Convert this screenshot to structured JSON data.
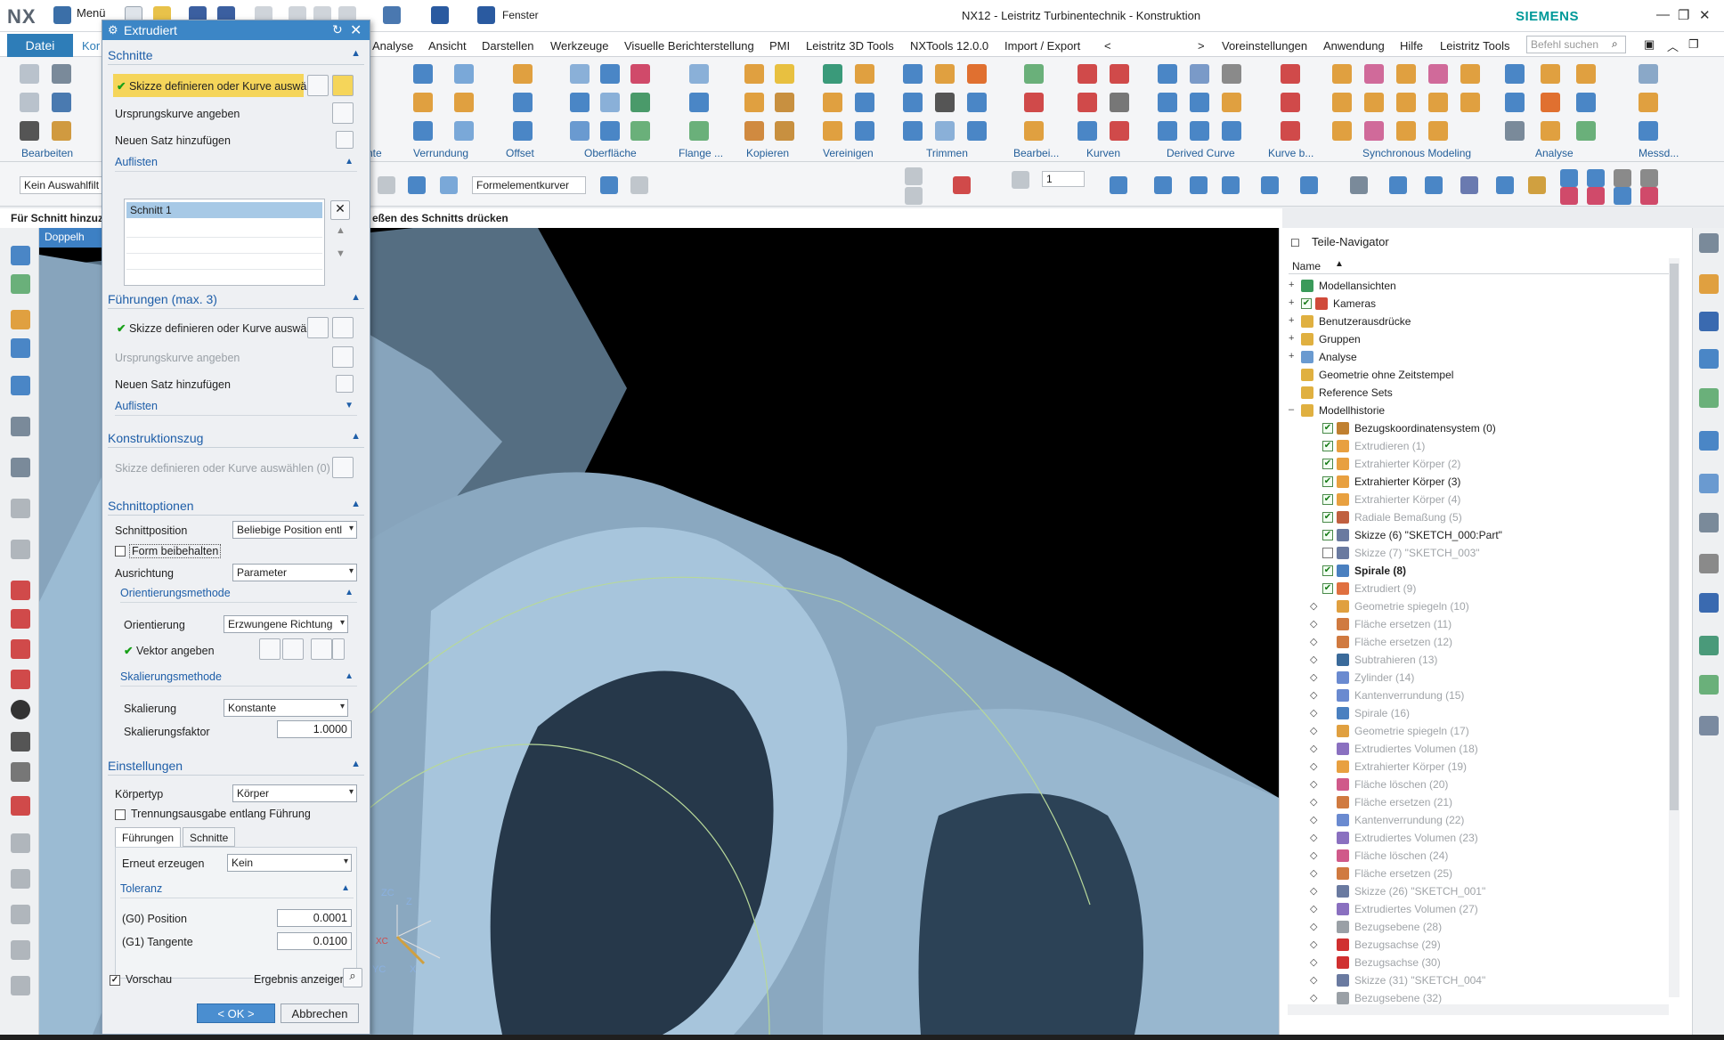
{
  "app": {
    "logo": "NX",
    "menu_label": "Menü",
    "window_menu": "Fenster",
    "title": "NX12 - Leistritz Turbinentechnik - Konstruktion",
    "brand": "SIEMENS",
    "accent_color": "#2e7db8"
  },
  "ribbon": {
    "file_tab": "Datei",
    "partial_tab": "Kor",
    "tabs": [
      "Analyse",
      "Ansicht",
      "Darstellen",
      "Werkzeuge",
      "Visuelle Berichterstellung",
      "PMI",
      "Leistritz 3D Tools",
      "NXTools 12.0.0",
      "Import / Export",
      "<",
      ">",
      "Voreinstellungen",
      "Anwendung",
      "Hilfe",
      "Leistritz Tools"
    ],
    "search_placeholder": "Befehl suchen",
    "groups": [
      "Bearbeiten",
      "nte",
      "Verrundung",
      "Offset",
      "Oberfläche",
      "Flange ...",
      "Kopieren",
      "Vereinigen",
      "Trimmen",
      "Bearbei...",
      "Kurven",
      "Derived Curve",
      "Kurve b...",
      "Synchronous Modeling",
      "Analyse",
      "Messd..."
    ]
  },
  "toolbar2": {
    "selection_filter": "Kein Auswahlfilt",
    "curve_rule": "Formelementkurver",
    "layer_value": "1"
  },
  "statusline": {
    "left": "Für Schnitt hinzuzu",
    "right": "eßen des Schnitts drücken"
  },
  "viewport": {
    "tab_label": "Doppelh",
    "axis_zc": "ZC",
    "axis_z": "Z",
    "axis_yc": "YC",
    "axis_y": "Y",
    "axis_x": "X",
    "axis_xc": "XC"
  },
  "dialog": {
    "title": "Extrudiert",
    "sections": {
      "schnitte": {
        "title": "Schnitte",
        "define_sketch": "Skizze definieren oder Kurve auswäh",
        "origin_curve": "Ursprungskurve angeben",
        "add_set": "Neuen Satz hinzufügen",
        "list_title": "Auflisten",
        "list_items": [
          "Schnitt 1"
        ]
      },
      "fuehrungen": {
        "title": "Führungen (max. 3)",
        "define_sketch": "Skizze definieren oder Kurve auswähl",
        "origin_curve": "Ursprungskurve angeben",
        "add_set": "Neuen Satz hinzufügen",
        "list_title": "Auflisten"
      },
      "konstruktionszug": {
        "title": "Konstruktionszug",
        "define_sketch": "Skizze definieren oder Kurve auswählen (0)"
      },
      "schnittoptionen": {
        "title": "Schnittoptionen",
        "position_label": "Schnittposition",
        "position_value": "Beliebige Position entl",
        "keep_shape": "Form beibehalten",
        "alignment_label": "Ausrichtung",
        "alignment_value": "Parameter",
        "orientation_method": "Orientierungsmethode",
        "orientation_label": "Orientierung",
        "orientation_value": "Erzwungene Richtung",
        "vector_label": "Vektor angeben",
        "scaling_method": "Skalierungsmethode",
        "scaling_label": "Skalierung",
        "scaling_value": "Konstante",
        "scale_factor_label": "Skalierungsfaktor",
        "scale_factor_value": "1.0000"
      },
      "einstellungen": {
        "title": "Einstellungen",
        "body_type_label": "Körpertyp",
        "body_type_value": "Körper",
        "split_output": "Trennungsausgabe entlang Führung",
        "tab_guides": "Führungen",
        "tab_sections": "Schnitte",
        "rebuild_label": "Erneut erzeugen",
        "rebuild_value": "Kein",
        "tolerance_title": "Toleranz",
        "g0_label": "(G0) Position",
        "g0_value": "0.0001",
        "g1_label": "(G1) Tangente",
        "g1_value": "0.0100"
      }
    },
    "preview_label": "Vorschau",
    "show_result": "Ergebnis anzeigen",
    "ok_label": "< OK >",
    "cancel_label": "Abbrechen"
  },
  "navigator": {
    "title": "Teile-Navigator",
    "column_name": "Name",
    "items": [
      {
        "label": "Modellansichten",
        "level": 0,
        "expander": "+",
        "check": "",
        "style": "normal",
        "icon_color": "#3a9a5a"
      },
      {
        "label": "Kameras",
        "level": 0,
        "expander": "+",
        "check": "✔",
        "style": "normal",
        "icon_color": "#d04a3a"
      },
      {
        "label": "Benutzerausdrücke",
        "level": 0,
        "expander": "+",
        "check": "",
        "style": "normal",
        "icon_color": "#e0b040"
      },
      {
        "label": "Gruppen",
        "level": 0,
        "expander": "+",
        "check": "",
        "style": "normal",
        "icon_color": "#e0b040"
      },
      {
        "label": "Analyse",
        "level": 0,
        "expander": "+",
        "check": "",
        "style": "normal",
        "icon_color": "#6a9ad0"
      },
      {
        "label": "Geometrie ohne Zeitstempel",
        "level": 0,
        "expander": "",
        "check": "",
        "style": "normal",
        "icon_color": "#e0b040"
      },
      {
        "label": "Reference Sets",
        "level": 0,
        "expander": "",
        "check": "",
        "style": "normal",
        "icon_color": "#e0b040"
      },
      {
        "label": "Modellhistorie",
        "level": 0,
        "expander": "–",
        "check": "",
        "style": "normal",
        "icon_color": "#e0b040"
      },
      {
        "label": "Bezugskoordinatensystem (0)",
        "level": 1,
        "expander": "",
        "check": "✔",
        "style": "normal",
        "icon_color": "#c08030"
      },
      {
        "label": "Extrudieren (1)",
        "level": 1,
        "expander": "",
        "check": "✔",
        "style": "grey",
        "icon_color": "#e8a040"
      },
      {
        "label": "Extrahierter Körper (2)",
        "level": 1,
        "expander": "",
        "check": "✔",
        "style": "grey",
        "icon_color": "#e8a040"
      },
      {
        "label": "Extrahierter Körper (3)",
        "level": 1,
        "expander": "",
        "check": "✔",
        "style": "normal",
        "icon_color": "#e8a040"
      },
      {
        "label": "Extrahierter Körper (4)",
        "level": 1,
        "expander": "",
        "check": "✔",
        "style": "grey",
        "icon_color": "#e8a040"
      },
      {
        "label": "Radiale Bemaßung (5)",
        "level": 1,
        "expander": "",
        "check": "✔",
        "style": "grey",
        "icon_color": "#c06040"
      },
      {
        "label": "Skizze (6) \"SKETCH_000:Part\"",
        "level": 1,
        "expander": "",
        "check": "✔",
        "style": "normal",
        "icon_color": "#6a7aa0"
      },
      {
        "label": "Skizze (7) \"SKETCH_003\"",
        "level": 1,
        "expander": "",
        "check": "empty",
        "style": "grey",
        "icon_color": "#6a7aa0"
      },
      {
        "label": "Spirale (8)",
        "level": 1,
        "expander": "",
        "check": "✔",
        "style": "bold",
        "icon_color": "#4a80c0"
      },
      {
        "label": "Extrudiert (9)",
        "level": 1,
        "expander": "",
        "check": "✔",
        "style": "grey",
        "icon_color": "#e07040"
      },
      {
        "label": "Geometrie spiegeln (10)",
        "level": 1,
        "expander": "◇",
        "check": "",
        "style": "grey",
        "icon_color": "#e0a040"
      },
      {
        "label": "Fläche ersetzen (11)",
        "level": 1,
        "expander": "◇",
        "check": "",
        "style": "grey",
        "icon_color": "#d07a40"
      },
      {
        "label": "Fläche ersetzen (12)",
        "level": 1,
        "expander": "◇",
        "check": "",
        "style": "grey",
        "icon_color": "#d07a40"
      },
      {
        "label": "Subtrahieren (13)",
        "level": 1,
        "expander": "◇",
        "check": "",
        "style": "grey",
        "icon_color": "#3a6a9a"
      },
      {
        "label": "Zylinder (14)",
        "level": 1,
        "expander": "◇",
        "check": "",
        "style": "grey",
        "icon_color": "#6a8ad0"
      },
      {
        "label": "Kantenverrundung (15)",
        "level": 1,
        "expander": "◇",
        "check": "",
        "style": "grey",
        "icon_color": "#6a8ad0"
      },
      {
        "label": "Spirale (16)",
        "level": 1,
        "expander": "◇",
        "check": "",
        "style": "grey",
        "icon_color": "#4a80c0"
      },
      {
        "label": "Geometrie spiegeln (17)",
        "level": 1,
        "expander": "◇",
        "check": "",
        "style": "grey",
        "icon_color": "#e0a040"
      },
      {
        "label": "Extrudiertes Volumen (18)",
        "level": 1,
        "expander": "◇",
        "check": "",
        "style": "grey",
        "icon_color": "#8a70c0"
      },
      {
        "label": "Extrahierter Körper (19)",
        "level": 1,
        "expander": "◇",
        "check": "",
        "style": "grey",
        "icon_color": "#e8a040"
      },
      {
        "label": "Fläche löschen (20)",
        "level": 1,
        "expander": "◇",
        "check": "",
        "style": "grey",
        "icon_color": "#d05a8a"
      },
      {
        "label": "Fläche ersetzen (21)",
        "level": 1,
        "expander": "◇",
        "check": "",
        "style": "grey",
        "icon_color": "#d07a40"
      },
      {
        "label": "Kantenverrundung (22)",
        "level": 1,
        "expander": "◇",
        "check": "",
        "style": "grey",
        "icon_color": "#6a8ad0"
      },
      {
        "label": "Extrudiertes Volumen (23)",
        "level": 1,
        "expander": "◇",
        "check": "",
        "style": "grey",
        "icon_color": "#8a70c0"
      },
      {
        "label": "Fläche löschen (24)",
        "level": 1,
        "expander": "◇",
        "check": "",
        "style": "grey",
        "icon_color": "#d05a8a"
      },
      {
        "label": "Fläche ersetzen (25)",
        "level": 1,
        "expander": "◇",
        "check": "",
        "style": "grey",
        "icon_color": "#d07a40"
      },
      {
        "label": "Skizze (26) \"SKETCH_001\"",
        "level": 1,
        "expander": "◇",
        "check": "",
        "style": "grey",
        "icon_color": "#6a7aa0"
      },
      {
        "label": "Extrudiertes Volumen (27)",
        "level": 1,
        "expander": "◇",
        "check": "",
        "style": "grey",
        "icon_color": "#8a70c0"
      },
      {
        "label": "Bezugsebene (28)",
        "level": 1,
        "expander": "◇",
        "check": "",
        "style": "grey",
        "icon_color": "#9aa0a6"
      },
      {
        "label": "Bezugsachse (29)",
        "level": 1,
        "expander": "◇",
        "check": "",
        "style": "grey",
        "icon_color": "#d03030"
      },
      {
        "label": "Bezugsachse (30)",
        "level": 1,
        "expander": "◇",
        "check": "",
        "style": "grey",
        "icon_color": "#d03030"
      },
      {
        "label": "Skizze (31) \"SKETCH_004\"",
        "level": 1,
        "expander": "◇",
        "check": "",
        "style": "grey",
        "icon_color": "#6a7aa0"
      },
      {
        "label": "Bezugsebene (32)",
        "level": 1,
        "expander": "◇",
        "check": "",
        "style": "grey",
        "icon_color": "#9aa0a6"
      }
    ]
  }
}
